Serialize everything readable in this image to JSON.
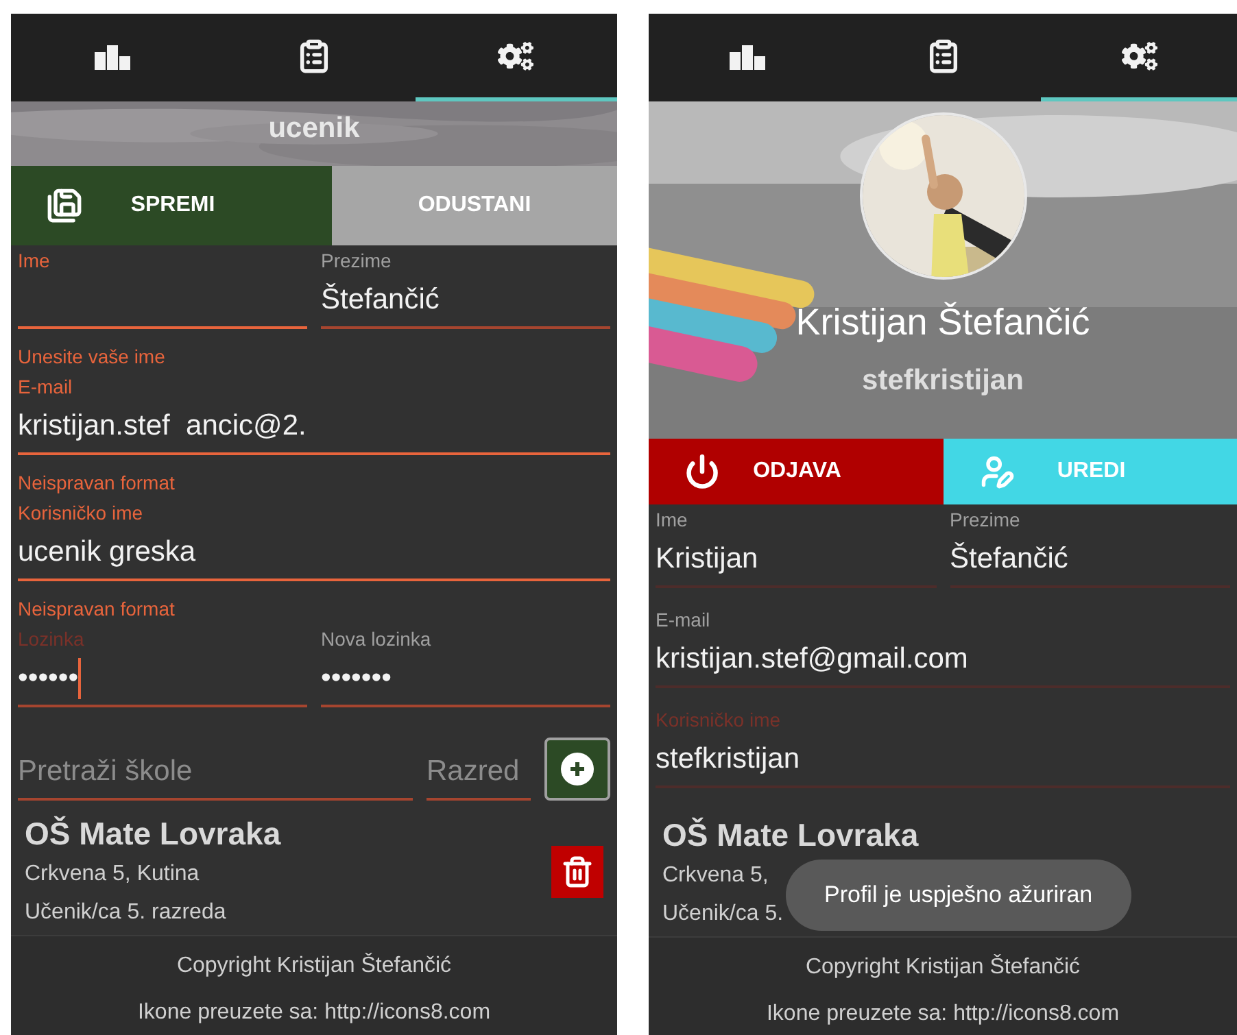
{
  "screens": [
    {
      "kind": "edit",
      "editable": true,
      "tabs": [
        {
          "kind": "podium",
          "selected": false
        },
        {
          "kind": "clipboard",
          "selected": false
        },
        {
          "kind": "settings",
          "selected": true
        }
      ],
      "header": {
        "username": "ucenik"
      },
      "actions": [
        {
          "kind": "save",
          "label": "SPREMI"
        },
        {
          "kind": "cancel",
          "label": "ODUSTANI"
        }
      ],
      "field_rows": [
        [
          {
            "label": "Ime",
            "kind": "invalid",
            "error": "Unesite vaše ime"
          },
          {
            "label": "Prezime",
            "value": "Štefančić",
            "kind": "normal"
          }
        ],
        [
          {
            "label": "E-mail",
            "value": "kristijan.stef  ancic@2.",
            "kind": "invalid",
            "error": "Neispravan format"
          }
        ],
        [
          {
            "label": "Korisničko ime",
            "value": "ucenik greska",
            "kind": "invalid",
            "error": "Neispravan format"
          }
        ],
        [
          {
            "label": "Lozinka",
            "value": "••••••",
            "kind": "active",
            "cursor": true
          },
          {
            "label": "Nova lozinka",
            "value": "•••••••",
            "kind": "normal"
          }
        ]
      ],
      "search": {
        "school_placeholder": "Pretraži škole",
        "grade_placeholder": "Razred"
      },
      "school": {
        "name": "OŠ Mate Lovraka",
        "address": "Crkvena 5, Kutina",
        "role": "Učenik/ca 5. razreda",
        "deletable": true
      },
      "footer": {
        "copyright": "Copyright Kristijan Štefančić",
        "credits": "Ikone preuzete sa: http://icons8.com"
      }
    },
    {
      "kind": "profile",
      "editable": false,
      "tabs": [
        {
          "kind": "podium",
          "selected": false
        },
        {
          "kind": "clipboard",
          "selected": false
        },
        {
          "kind": "settings",
          "selected": true
        }
      ],
      "header": {
        "name": "Kristijan Štefančić",
        "username": "stefkristijan"
      },
      "actions": [
        {
          "kind": "logout",
          "label": "ODJAVA"
        },
        {
          "kind": "edit",
          "label": "UREDI"
        }
      ],
      "field_rows": [
        [
          {
            "label": "Ime",
            "value": "Kristijan",
            "kind": "normal"
          },
          {
            "label": "Prezime",
            "value": "Štefančić",
            "kind": "normal"
          }
        ],
        [
          {
            "label": "E-mail",
            "value": "kristijan.stef@gmail.com",
            "kind": "normal"
          }
        ],
        [
          {
            "label": "Korisničko ime",
            "value": "stefkristijan",
            "kind": "active"
          }
        ]
      ],
      "school": {
        "name": "OŠ Mate Lovraka",
        "address": "Crkvena 5,",
        "role": "Učenik/ca 5."
      },
      "toast": "Profil je uspješno ažuriran",
      "footer": {
        "copyright": "Copyright Kristijan Štefančić",
        "credits": "Ikone preuzete sa: http://icons8.com"
      }
    }
  ]
}
